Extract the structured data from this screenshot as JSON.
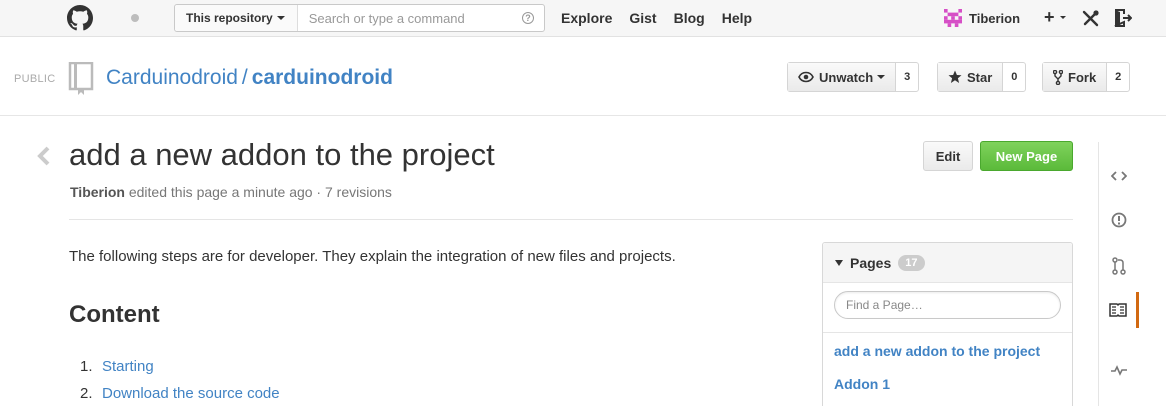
{
  "header": {
    "scope_label": "This repository",
    "search_placeholder": "Search or type a command",
    "help_glyph": "?",
    "nav": [
      "Explore",
      "Gist",
      "Blog",
      "Help"
    ],
    "username": "Tiberion",
    "plus_glyph": "+",
    "icons": [
      "github-logo-icon",
      "notification-dot-icon",
      "search-help-icon",
      "identicon-avatar",
      "plus-icon",
      "tools-icon",
      "sign-out-icon"
    ]
  },
  "repo": {
    "visibility": "PUBLIC",
    "owner": "Carduinodroid",
    "separator": "/",
    "name": "carduinodroid",
    "unwatch_label": "Unwatch",
    "unwatch_count": "3",
    "star_label": "Star",
    "star_count": "0",
    "fork_label": "Fork",
    "fork_count": "2"
  },
  "wiki": {
    "title": "add a new addon to the project",
    "author": "Tiberion",
    "edited_text": " edited this page a minute ago · 7 revisions",
    "edit_label": "Edit",
    "new_page_label": "New Page",
    "intro": "The following steps are for developer. They explain the integration of new files and projects.",
    "content_heading": "Content",
    "toc": [
      {
        "num": "1.",
        "label": "Starting"
      },
      {
        "num": "2.",
        "label": "Download the source code"
      }
    ]
  },
  "pages_box": {
    "label": "Pages",
    "count": "17",
    "find_placeholder": "Find a Page…",
    "links": [
      "add a new addon to the project",
      "Addon 1"
    ]
  },
  "colors": {
    "link": "#4183c4",
    "green_button": "#5bba3a",
    "active_nav_accent": "#d26911",
    "identicon": "#d64fc6"
  }
}
